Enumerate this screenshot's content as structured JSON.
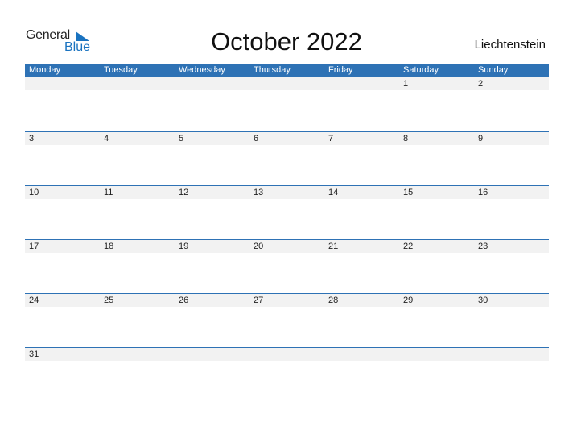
{
  "logo": {
    "general": "General",
    "blue": "Blue"
  },
  "title": "October 2022",
  "country": "Liechtenstein",
  "colors": {
    "accent": "#2e72b5",
    "band": "#f2f2f2"
  },
  "weekdays": [
    "Monday",
    "Tuesday",
    "Wednesday",
    "Thursday",
    "Friday",
    "Saturday",
    "Sunday"
  ],
  "weeks": [
    [
      "",
      "",
      "",
      "",
      "",
      "1",
      "2"
    ],
    [
      "3",
      "4",
      "5",
      "6",
      "7",
      "8",
      "9"
    ],
    [
      "10",
      "11",
      "12",
      "13",
      "14",
      "15",
      "16"
    ],
    [
      "17",
      "18",
      "19",
      "20",
      "21",
      "22",
      "23"
    ],
    [
      "24",
      "25",
      "26",
      "27",
      "28",
      "29",
      "30"
    ],
    [
      "31",
      "",
      "",
      "",
      "",
      "",
      ""
    ]
  ]
}
